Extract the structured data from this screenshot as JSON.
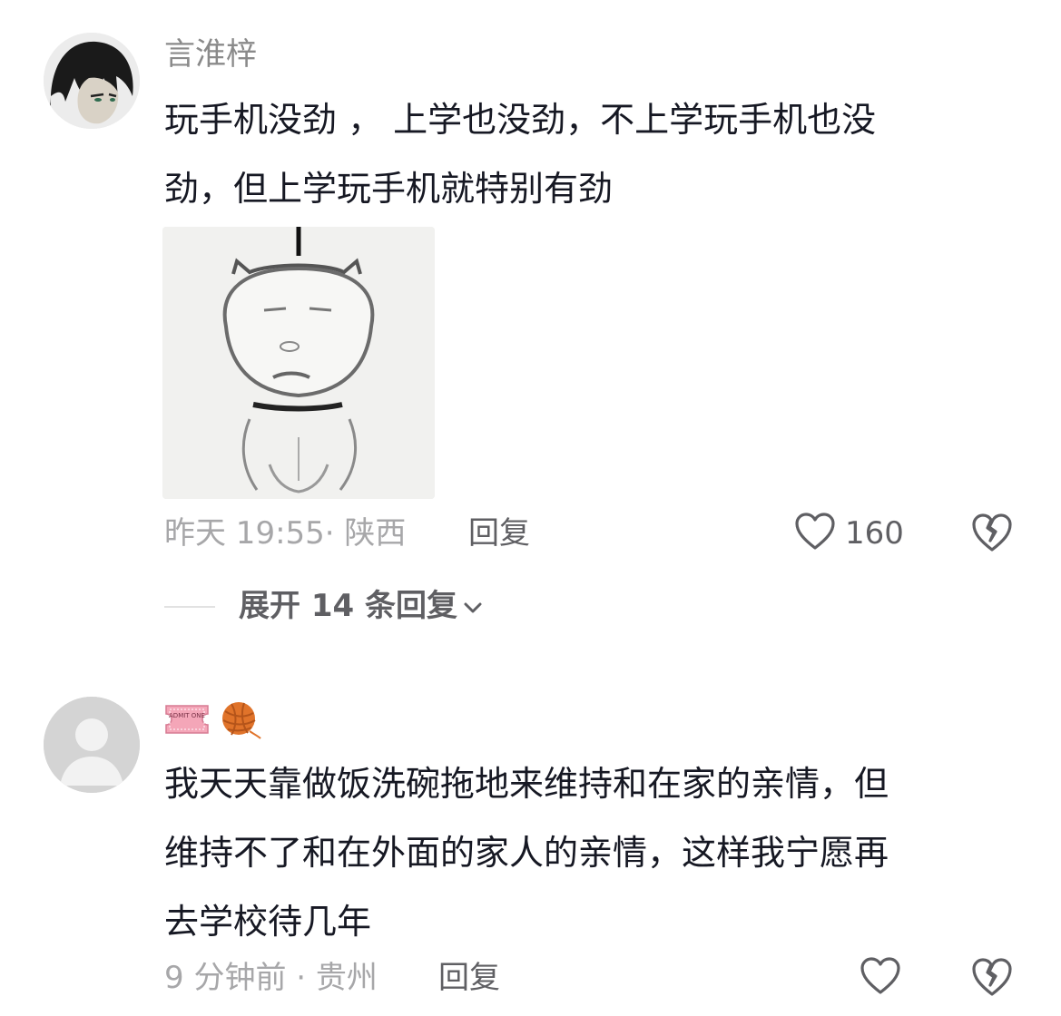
{
  "comments": [
    {
      "username": "言淮梓",
      "text_lines": [
        "玩手机没劲 ， 上学也没劲，不上学玩手机也没",
        "劲，但上学玩手机就特别有劲"
      ],
      "time_location": "昨天 19:55· 陕西",
      "reply_label": "回复",
      "like_count": "160",
      "expand_label": "展开 14 条回复"
    },
    {
      "badges": [
        {
          "icon": "admit-one-ticket-badge",
          "label": "ADMIT ONE"
        },
        {
          "icon": "yarn-ball-badge"
        }
      ],
      "text_lines": [
        "我天天靠做饭洗碗拖地来维持和在家的亲情，但",
        "维持不了和在外面的家人的亲情，这样我宁愿再",
        "去学校待几年"
      ],
      "time_location": "9 分钟前 · 贵州",
      "reply_label": "回复",
      "like_count": ""
    }
  ],
  "icons": {
    "like": "heart-outline-icon",
    "dislike": "broken-heart-icon",
    "expand": "chevron-down-icon",
    "avatar_placeholder": "default-person-icon"
  },
  "colors": {
    "primary_text": "#161823",
    "secondary_text": "#a7a7a9",
    "action_text": "#5f5f63",
    "ticket_pink": "#f4a6b8"
  }
}
